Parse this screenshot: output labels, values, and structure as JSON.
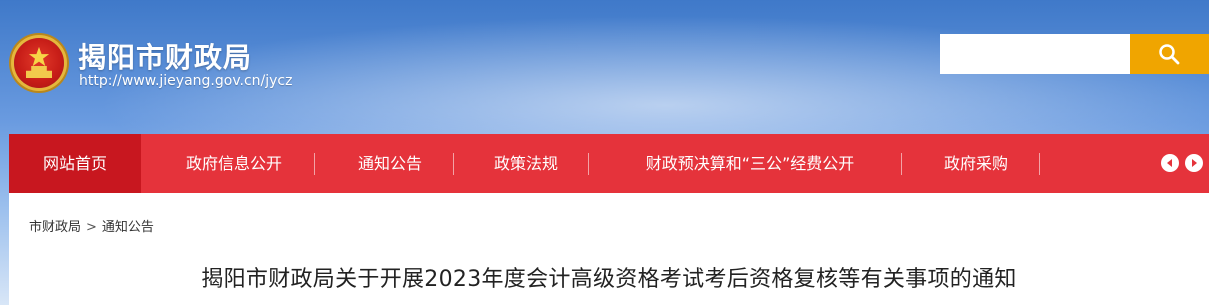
{
  "header": {
    "site_title": "揭阳市财政局",
    "site_url": "http://www.jieyang.gov.cn/jycz"
  },
  "search": {
    "value": "",
    "icon": "search-icon"
  },
  "nav": {
    "items": [
      {
        "label": "网站首页",
        "active": true
      },
      {
        "label": "政府信息公开",
        "active": false
      },
      {
        "label": "通知公告",
        "active": false
      },
      {
        "label": "政策法规",
        "active": false
      },
      {
        "label": "财政预决算和“三公”经费公开",
        "active": false
      },
      {
        "label": "政府采购",
        "active": false
      }
    ],
    "prev_icon": "arrow-left-icon",
    "next_icon": "arrow-right-icon"
  },
  "breadcrumb": {
    "items": [
      "市财政局",
      "通知公告"
    ],
    "separator": ">"
  },
  "article": {
    "title": "揭阳市财政局关于开展2023年度会计高级资格考试考后资格复核等有关事项的通知"
  },
  "colors": {
    "nav_bg": "#e5333b",
    "nav_active": "#c8171f",
    "search_button": "#f0a500"
  }
}
